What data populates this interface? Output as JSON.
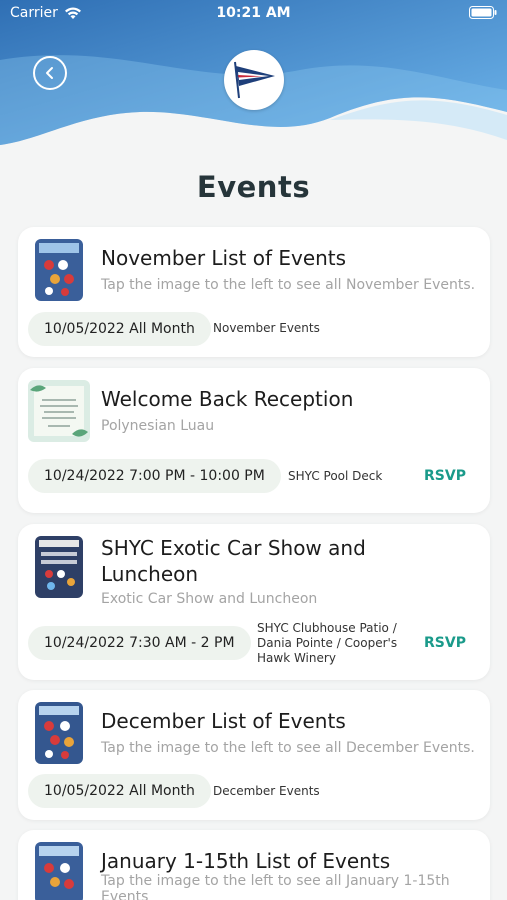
{
  "status_bar": {
    "carrier": "Carrier",
    "time": "10:21 AM"
  },
  "page": {
    "title": "Events"
  },
  "colors": {
    "accent": "#1a9a8a",
    "header_blue": "#3f87c8",
    "pill_bg": "#eef3ee"
  },
  "events": [
    {
      "title": "November List of Events",
      "subtitle": "Tap the image to the left to see all November Events.",
      "date": "10/05/2022 All Month",
      "location": "November Events",
      "rsvp": ""
    },
    {
      "title": "Welcome Back Reception",
      "subtitle": "Polynesian Luau",
      "date": "10/24/2022 7:00 PM - 10:00 PM",
      "location": "SHYC Pool Deck",
      "rsvp": "RSVP"
    },
    {
      "title_line1": "SHYC Exotic Car Show and",
      "title_line2": "Luncheon",
      "subtitle": "Exotic Car Show and Luncheon",
      "date": "10/24/2022 7:30 AM - 2 PM",
      "location_line1": "SHYC Clubhouse Patio /",
      "location_line2": "Dania Pointe / Cooper's",
      "location_line3": "Hawk Winery",
      "rsvp": "RSVP"
    },
    {
      "title": "December List of Events",
      "subtitle": "Tap the image to the left to see all December Events.",
      "date": "10/05/2022 All Month",
      "location": "December Events",
      "rsvp": ""
    },
    {
      "title": "January 1-15th List of Events",
      "subtitle_line1": "Tap the image to the left to see all January 1-15th",
      "subtitle_line2": "Events"
    }
  ]
}
